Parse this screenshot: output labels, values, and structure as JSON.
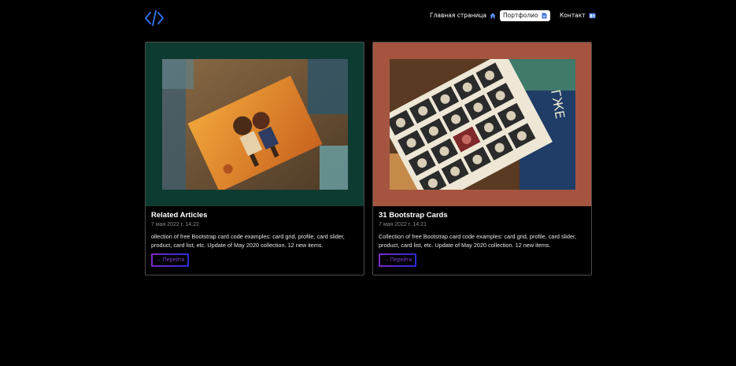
{
  "header": {
    "logo_icon": "code-brackets-icon",
    "nav": [
      {
        "label": "Главная страница",
        "icon": "home-icon",
        "active": false
      },
      {
        "label": "Портфолио",
        "icon": "document-icon",
        "active": true
      },
      {
        "label": "Контакт",
        "icon": "contact-card-icon",
        "active": false
      }
    ]
  },
  "cards": [
    {
      "title": "Related Articles",
      "date": "7 мая 2022 г. 14:22",
      "text": "ollection of free Bootstrap card code examples: card grid, profile, card slider, product, card list, etc. Update of May 2020 collection. 12 new items.",
      "button_arrow": "→",
      "button_label": "Перейти",
      "frame_color": "#0e3b31"
    },
    {
      "title": "31 Bootstrap Cards",
      "date": "7 мая 2022 г. 14:21",
      "text": "Collection of free Bootstrap card code examples: card grid, profile, card slider, product, card list, etc. Update of May 2020 collection. 12 new items.",
      "button_arrow": "→",
      "button_label": "Перейти",
      "frame_color": "#a5553f"
    }
  ],
  "colors": {
    "accent_blue": "#2f6fe6",
    "button_gradient_start": "#7a2bc4",
    "button_gradient_end": "#2a2ad8"
  }
}
